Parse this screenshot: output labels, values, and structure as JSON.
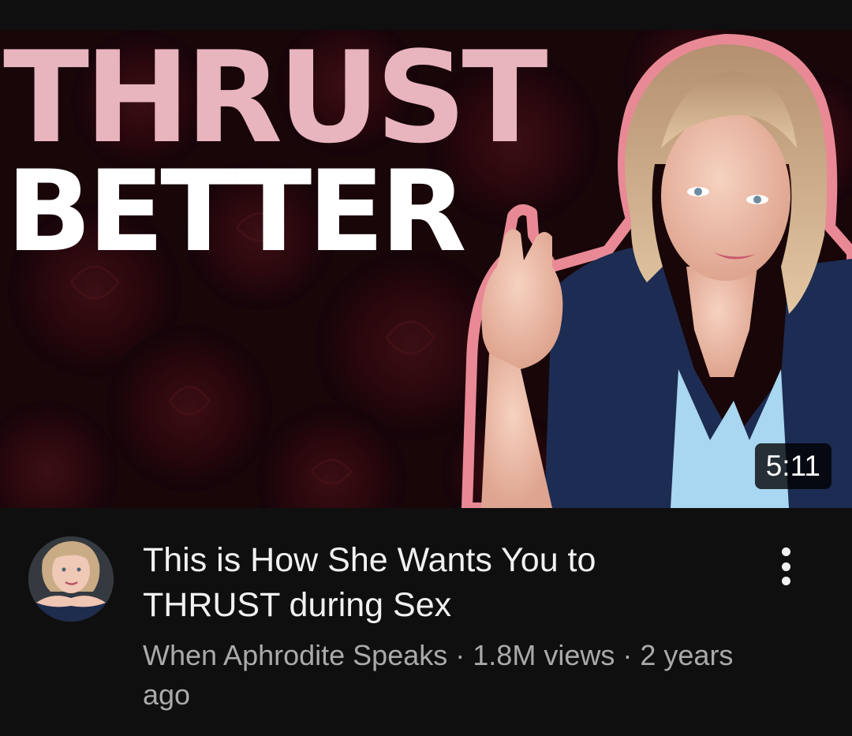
{
  "video": {
    "thumbnail": {
      "headline_line1": "THRUST",
      "headline_line2": "BETTER",
      "duration": "5:11"
    },
    "title": "This is How She Wants You to THRUST during Sex",
    "channel": "When Aphrodite Speaks",
    "separator": "·",
    "views": "1.8M views",
    "age": "2 years ago",
    "more_icon": "more-vert-icon"
  },
  "colors": {
    "background": "#0f0f0f",
    "title_text": "#f1f1f1",
    "secondary_text": "#aaaaaa",
    "headline_pink": "#e8b4bd",
    "headline_white": "#ffffff",
    "thumbnail_outline_pink": "#e98996",
    "blazer_navy": "#1d2c52",
    "top_light_blue": "#a9d6f0"
  }
}
